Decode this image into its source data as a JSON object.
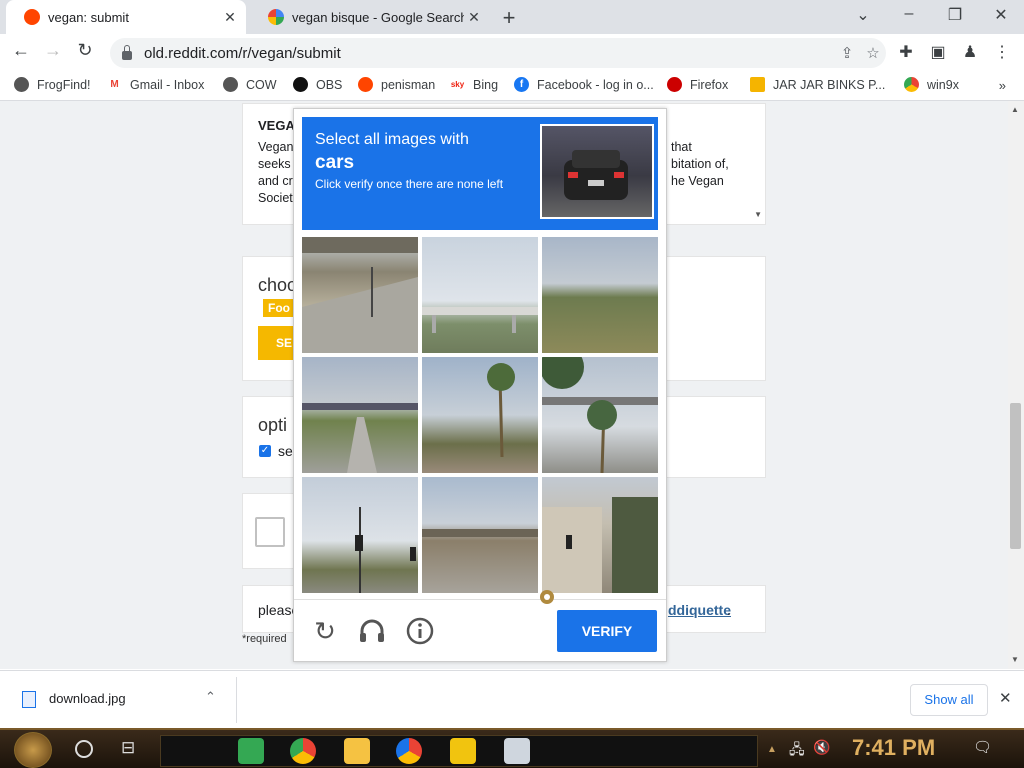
{
  "tabs": [
    {
      "title": "vegan: submit",
      "active": true,
      "favicon": "reddit-icon"
    },
    {
      "title": "vegan bisque - Google Search",
      "active": false,
      "favicon": "google-icon"
    }
  ],
  "window_controls": {
    "list": "⌄",
    "minimize": "–",
    "restore": "❐",
    "close": "✕"
  },
  "toolbar": {
    "url": "old.reddit.com/r/vegan/submit"
  },
  "bookmarks": [
    {
      "label": "FrogFind!",
      "icon": "globe-icon"
    },
    {
      "label": "Gmail - Inbox",
      "icon": "gmail-icon"
    },
    {
      "label": "COW",
      "icon": "globe-icon"
    },
    {
      "label": "OBS",
      "icon": "github-icon"
    },
    {
      "label": "penisman",
      "icon": "reddit-icon"
    },
    {
      "label": "Bing",
      "icon": "sky-icon"
    },
    {
      "label": "Facebook - log in o...",
      "icon": "facebook-icon"
    },
    {
      "label": "Firefox",
      "icon": "firefox-icon"
    },
    {
      "label": "JAR JAR BINKS P...",
      "icon": "bag-icon"
    },
    {
      "label": "win9x",
      "icon": "chrome-icon"
    }
  ],
  "page": {
    "section1_heading": "VEGA",
    "section1_left": [
      "Vegan",
      "seeks",
      "and cr",
      "Societ"
    ],
    "section1_right": [
      "that",
      "bitation of,",
      "he Vegan"
    ],
    "choose_heading": "choo",
    "flair_label": "Foo",
    "select_btn": "SE",
    "options_heading": "opti",
    "options_check": "se",
    "please_text": "please",
    "reddiquette_link": "ddiquette",
    "required_text": "*required"
  },
  "captcha": {
    "line1": "Select all images with",
    "target": "cars",
    "line3": "Click verify once there are none left",
    "verify_label": "VERIFY",
    "tiles": [
      "overpass-tile",
      "bridge-tile",
      "field-tile",
      "road-bridge-tile",
      "palm-tree-tile",
      "palm-overpass-tile",
      "traffic-light-tile",
      "highway-bridge-tile",
      "building-tile"
    ]
  },
  "download": {
    "filename": "download.jpg",
    "show_all": "Show all"
  },
  "taskbar": {
    "time": "7:41 PM"
  }
}
